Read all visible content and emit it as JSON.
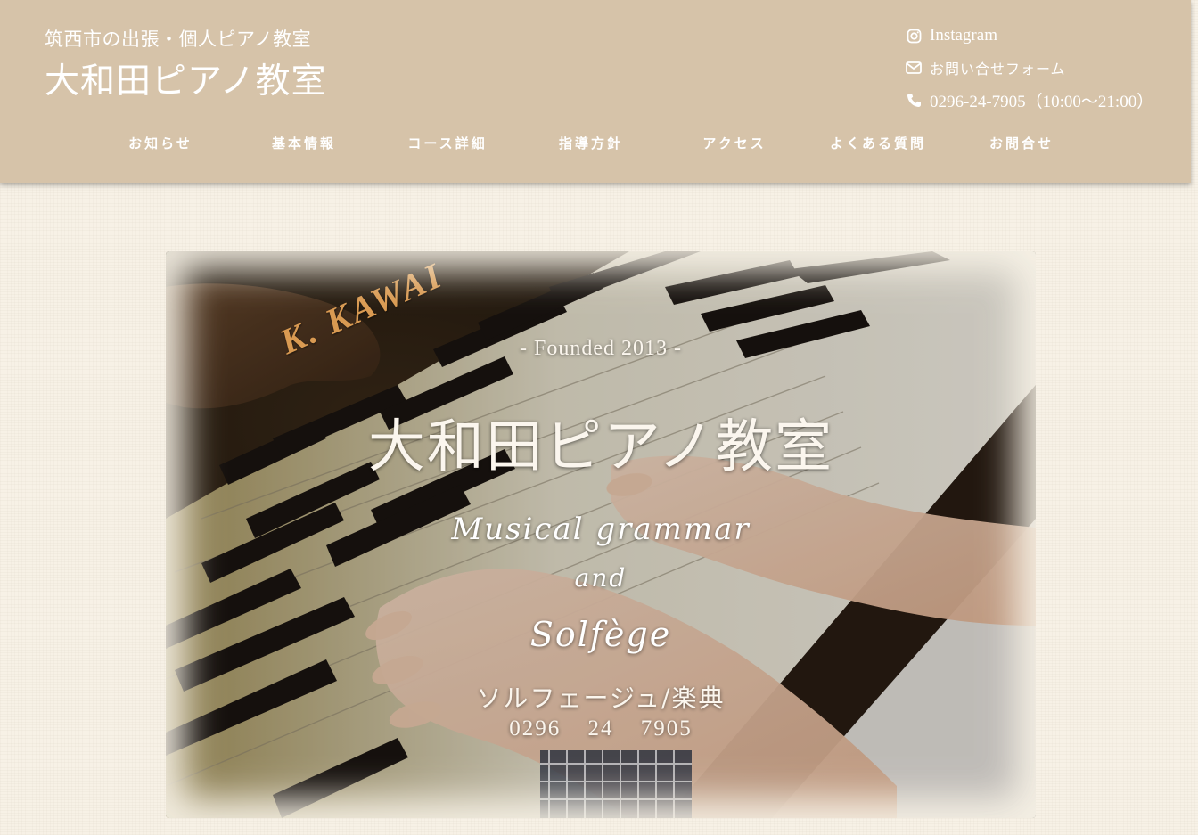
{
  "header": {
    "tagline": "筑西市の出張・個人ピアノ教室",
    "title": "大和田ピアノ教室",
    "contacts": {
      "instagram": "Instagram",
      "form": "お問い合せフォーム",
      "phone": "0296-24-7905（10:00〜21:00）"
    }
  },
  "nav": {
    "items": [
      {
        "label": "お知らせ"
      },
      {
        "label": "基本情報"
      },
      {
        "label": "コース詳細"
      },
      {
        "label": "指導方針"
      },
      {
        "label": "アクセス"
      },
      {
        "label": "よくある質問"
      },
      {
        "label": "お問合せ"
      }
    ]
  },
  "hero": {
    "piano_brand": "K. KAWAI",
    "founded": "- Founded 2013 -",
    "title": "大和田ピアノ教室",
    "script_line1": "Musical grammar",
    "script_line2": "and",
    "script_line3": "Solfège",
    "solfege_jp": "ソルフェージュ/楽典",
    "phone": "0296 24 7905"
  },
  "colors": {
    "header_bg": "#d6c3a9",
    "page_bg": "#f7f1e6",
    "brand_gold": "#d99a52"
  },
  "icons": [
    "instagram-icon",
    "envelope-icon",
    "phone-icon"
  ]
}
